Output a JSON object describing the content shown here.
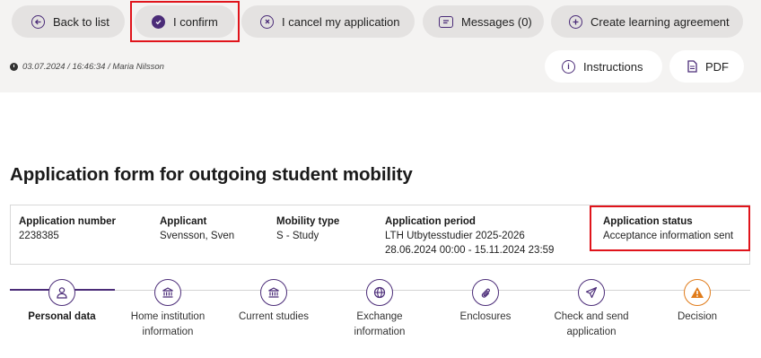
{
  "toolbar": {
    "back_label": "Back to list",
    "confirm_label": "I confirm",
    "cancel_label": "I cancel my application",
    "messages_label": "Messages (0)",
    "learning_label": "Create learning agreement",
    "instructions_label": "Instructions",
    "pdf_label": "PDF"
  },
  "meta": {
    "timestamp": "03.07.2024 / 16:46:34 / Maria Nilsson"
  },
  "page_title": "Application form for outgoing student mobility",
  "info": {
    "application_number": {
      "label": "Application number",
      "value": "2238385"
    },
    "applicant": {
      "label": "Applicant",
      "value": "Svensson, Sven"
    },
    "mobility_type": {
      "label": "Mobility type",
      "value": "S - Study"
    },
    "application_period": {
      "label": "Application period",
      "value_line1": "LTH Utbytesstudier 2025-2026",
      "value_line2": "28.06.2024 00:00 - 15.11.2024 23:59"
    },
    "application_status": {
      "label": "Application status",
      "value": "Acceptance information sent"
    }
  },
  "steps": [
    {
      "line1": "Personal data",
      "line2": ""
    },
    {
      "line1": "Home institution",
      "line2": "information"
    },
    {
      "line1": "Current studies",
      "line2": ""
    },
    {
      "line1": "Exchange",
      "line2": "information"
    },
    {
      "line1": "Enclosures",
      "line2": ""
    },
    {
      "line1": "Check and send",
      "line2": "application"
    },
    {
      "line1": "Decision",
      "line2": ""
    }
  ],
  "colors": {
    "accent": "#4b2c78",
    "highlight": "#e0141b",
    "warning": "#e07b1a"
  },
  "icons": {
    "back": "arrow-left-circle-icon",
    "confirm": "check-circle-icon",
    "cancel": "x-circle-icon",
    "messages": "message-icon",
    "learning": "plus-circle-icon",
    "instructions": "info-circle-icon",
    "pdf": "document-icon",
    "meta": "clock-icon",
    "steps": [
      "person-icon",
      "institution-icon",
      "institution-icon",
      "globe-icon",
      "paperclip-icon",
      "send-icon",
      "warning-icon"
    ]
  }
}
